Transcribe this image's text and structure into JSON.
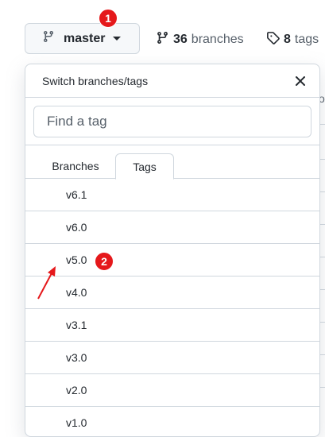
{
  "header": {
    "branch_button_label": "master",
    "branches_count": "36",
    "branches_label": "branches",
    "tags_count": "8",
    "tags_label": "tags"
  },
  "annotations": {
    "badge_1": "1",
    "badge_2": "2",
    "color": "#e5181b"
  },
  "dropdown": {
    "title": "Switch branches/tags",
    "filter_placeholder": "Find a tag",
    "tabs": [
      {
        "label": "Branches",
        "active": false
      },
      {
        "label": "Tags",
        "active": true
      }
    ],
    "items": [
      "v6.1",
      "v6.0",
      "v5.0",
      "v4.0",
      "v3.1",
      "v3.0",
      "v2.0",
      "v1.0"
    ]
  },
  "background": {
    "edge_letter": "o"
  },
  "icons": {
    "branch": "git-branch-icon",
    "tag": "tag-icon",
    "close": "close-icon",
    "caret": "caret-down-icon"
  }
}
